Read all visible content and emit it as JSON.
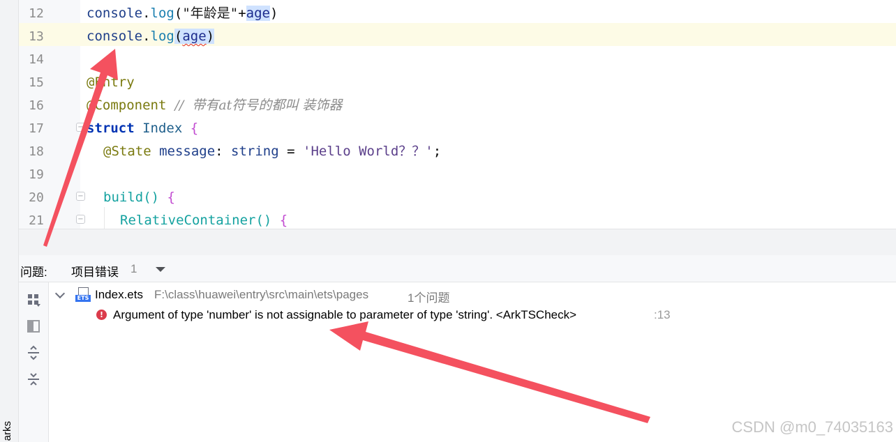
{
  "sidebar": {
    "vertical_label": "arks"
  },
  "editor": {
    "lines": [
      {
        "num": "12"
      },
      {
        "num": "13"
      },
      {
        "num": "14"
      },
      {
        "num": "15"
      },
      {
        "num": "16"
      },
      {
        "num": "17"
      },
      {
        "num": "18"
      },
      {
        "num": "19"
      },
      {
        "num": "20"
      },
      {
        "num": "21"
      }
    ],
    "tokens": {
      "l12_console": "console",
      "l12_dot": ".",
      "l12_log": "log",
      "l12_open": "(",
      "l12_str": "\"年龄是\"",
      "l12_plus": "+",
      "l12_age": "age",
      "l12_close": ")",
      "l13_console": "console",
      "l13_dot": ".",
      "l13_log": "log",
      "l13_open": "(",
      "l13_age": "age",
      "l13_close": ")",
      "l15_dec": "@Entry",
      "l16_dec": "@Component",
      "l16_comment": "  //  带有at符号的都叫 装饰器",
      "l17_kw": "struct",
      "l17_name": " Index ",
      "l17_brace": "{",
      "l18_dec": "@State",
      "l18_field": " message",
      "l18_colon": ": ",
      "l18_type": "string",
      "l18_eq": " = ",
      "l18_str": "'Hello World？？'",
      "l18_semi": ";",
      "l20_fn": "build",
      "l20_paren": "() ",
      "l20_brace": "{",
      "l21_fn": "RelativeContainer",
      "l21_paren": "() ",
      "l21_brace": "{"
    }
  },
  "problems_panel": {
    "title": "问题:",
    "tab_label": "项目错误",
    "tab_count": "1",
    "file": {
      "icon_label": "ETS",
      "name": "Index.ets",
      "path": "F:\\class\\huawei\\entry\\src\\main\\ets\\pages",
      "issue_count": "1个问题"
    },
    "error": {
      "message": "Argument of type 'number' is not assignable to parameter of type 'string'. <ArkTSCheck>",
      "line_ref": ":13"
    }
  },
  "watermark": "CSDN @m0_74035163",
  "colors": {
    "current_line": "#fdfbe6",
    "error_icon": "#db3b4b",
    "annotation_arrow": "#f4515f",
    "selection": "#cfe2ff"
  }
}
